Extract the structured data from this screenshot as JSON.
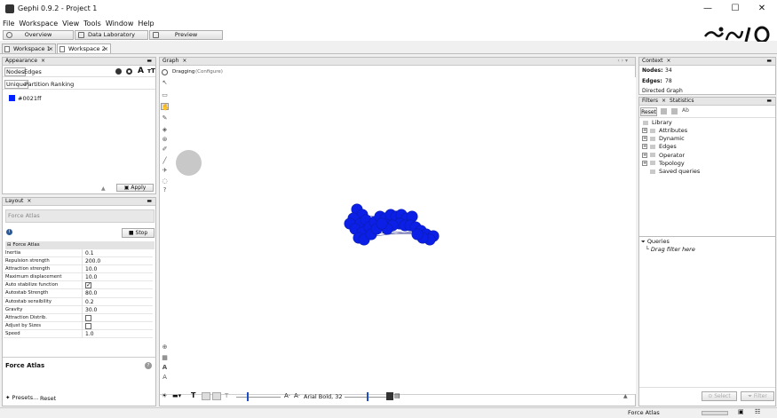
{
  "window": {
    "title": "Gephi 0.9.2 - Project 1",
    "minimize": "—",
    "maximize": "☐",
    "close": "✕"
  },
  "menu": [
    "File",
    "Workspace",
    "View",
    "Tools",
    "Window",
    "Help"
  ],
  "modes": {
    "overview": "Overview",
    "data_laboratory": "Data Laboratory",
    "preview": "Preview"
  },
  "workspace_tabs": [
    {
      "label": "Workspace 1",
      "close": "×"
    },
    {
      "label": "Workspace 2",
      "close": "×"
    }
  ],
  "appearance": {
    "title": "Appearance",
    "close": "×",
    "tabs": [
      "Nodes",
      "Edges"
    ],
    "subtabs": [
      "Unique",
      "Partition",
      "Ranking"
    ],
    "color_label": "#0021ff",
    "color": "#0021ff",
    "apply": "Apply"
  },
  "layout": {
    "title": "Layout",
    "close": "×",
    "algorithm_placeholder": "Force Atlas",
    "stop": "Stop",
    "section": "Force Atlas",
    "properties": [
      {
        "name": "Inertia",
        "value": "0.1"
      },
      {
        "name": "Repulsion strength",
        "value": "200.0"
      },
      {
        "name": "Attraction strength",
        "value": "10.0"
      },
      {
        "name": "Maximum displacement",
        "value": "10.0"
      },
      {
        "name": "Auto stabilize function",
        "checked": true
      },
      {
        "name": "Autostab Strength",
        "value": "80.0"
      },
      {
        "name": "Autostab sensibility",
        "value": "0.2"
      },
      {
        "name": "Gravity",
        "value": "30.0"
      },
      {
        "name": "Attraction Distrib.",
        "checked": false
      },
      {
        "name": "Adjust by Sizes",
        "checked": false
      },
      {
        "name": "Speed",
        "value": "1.0"
      }
    ],
    "description_title": "Force Atlas",
    "presets": "Presets...",
    "reset": "Reset"
  },
  "graph": {
    "title": "Graph",
    "close": "×",
    "mode_label": "Dragging",
    "configure": "(Configure)",
    "nav_arrows": "‹ › ▾",
    "font_label": "Arial Bold, 32",
    "node_color": "#0b1fe6"
  },
  "context": {
    "title": "Context",
    "close": "×",
    "nodes_label": "Nodes:",
    "nodes_value": "34",
    "edges_label": "Edges:",
    "edges_value": "78",
    "graph_type": "Directed Graph"
  },
  "filters": {
    "tab_filters": "Filters",
    "tab_statistics": "Statistics",
    "close": "×",
    "reset": "Reset",
    "library": "Library",
    "items": [
      "Attributes",
      "Dynamic",
      "Edges",
      "Operator",
      "Topology"
    ],
    "saved_queries": "Saved queries",
    "queries": "Queries",
    "drag_hint": "Drag filter here",
    "select": "Select",
    "filter": "Filter"
  },
  "status": {
    "layout_name": "Force Atlas"
  }
}
